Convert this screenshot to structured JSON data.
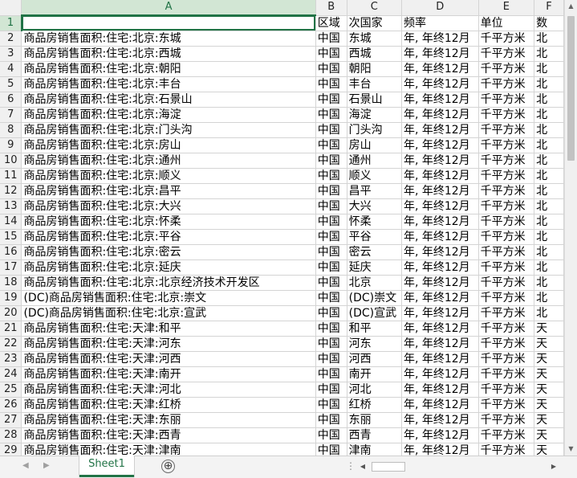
{
  "columns": [
    "A",
    "B",
    "C",
    "D",
    "E",
    "F"
  ],
  "header": [
    "",
    "区域",
    "次国家",
    "频率",
    "单位",
    "数"
  ],
  "rows": [
    [
      "1",
      "",
      "区域",
      "次国家",
      "频率",
      "单位",
      "数"
    ],
    [
      "2",
      "商品房销售面积:住宅:北京:东城",
      "中国",
      "东城",
      "年, 年终12月",
      "千平方米",
      "北"
    ],
    [
      "3",
      "商品房销售面积:住宅:北京:西城",
      "中国",
      "西城",
      "年, 年终12月",
      "千平方米",
      "北"
    ],
    [
      "4",
      "商品房销售面积:住宅:北京:朝阳",
      "中国",
      "朝阳",
      "年, 年终12月",
      "千平方米",
      "北"
    ],
    [
      "5",
      "商品房销售面积:住宅:北京:丰台",
      "中国",
      "丰台",
      "年, 年终12月",
      "千平方米",
      "北"
    ],
    [
      "6",
      "商品房销售面积:住宅:北京:石景山",
      "中国",
      "石景山",
      "年, 年终12月",
      "千平方米",
      "北"
    ],
    [
      "7",
      "商品房销售面积:住宅:北京:海淀",
      "中国",
      "海淀",
      "年, 年终12月",
      "千平方米",
      "北"
    ],
    [
      "8",
      "商品房销售面积:住宅:北京:门头沟",
      "中国",
      "门头沟",
      "年, 年终12月",
      "千平方米",
      "北"
    ],
    [
      "9",
      "商品房销售面积:住宅:北京:房山",
      "中国",
      "房山",
      "年, 年终12月",
      "千平方米",
      "北"
    ],
    [
      "10",
      "商品房销售面积:住宅:北京:通州",
      "中国",
      "通州",
      "年, 年终12月",
      "千平方米",
      "北"
    ],
    [
      "11",
      "商品房销售面积:住宅:北京:顺义",
      "中国",
      "顺义",
      "年, 年终12月",
      "千平方米",
      "北"
    ],
    [
      "12",
      "商品房销售面积:住宅:北京:昌平",
      "中国",
      "昌平",
      "年, 年终12月",
      "千平方米",
      "北"
    ],
    [
      "13",
      "商品房销售面积:住宅:北京:大兴",
      "中国",
      "大兴",
      "年, 年终12月",
      "千平方米",
      "北"
    ],
    [
      "14",
      "商品房销售面积:住宅:北京:怀柔",
      "中国",
      "怀柔",
      "年, 年终12月",
      "千平方米",
      "北"
    ],
    [
      "15",
      "商品房销售面积:住宅:北京:平谷",
      "中国",
      "平谷",
      "年, 年终12月",
      "千平方米",
      "北"
    ],
    [
      "16",
      "商品房销售面积:住宅:北京:密云",
      "中国",
      "密云",
      "年, 年终12月",
      "千平方米",
      "北"
    ],
    [
      "17",
      "商品房销售面积:住宅:北京:延庆",
      "中国",
      "延庆",
      "年, 年终12月",
      "千平方米",
      "北"
    ],
    [
      "18",
      "商品房销售面积:住宅:北京:北京经济技术开发区",
      "中国",
      "北京",
      "年, 年终12月",
      "千平方米",
      "北"
    ],
    [
      "19",
      "(DC)商品房销售面积:住宅:北京:崇文",
      "中国",
      "(DC)崇文",
      "年, 年终12月",
      "千平方米",
      "北"
    ],
    [
      "20",
      "(DC)商品房销售面积:住宅:北京:宣武",
      "中国",
      "(DC)宣武",
      "年, 年终12月",
      "千平方米",
      "北"
    ],
    [
      "21",
      "商品房销售面积:住宅:天津:和平",
      "中国",
      "和平",
      "年, 年终12月",
      "千平方米",
      "天"
    ],
    [
      "22",
      "商品房销售面积:住宅:天津:河东",
      "中国",
      "河东",
      "年, 年终12月",
      "千平方米",
      "天"
    ],
    [
      "23",
      "商品房销售面积:住宅:天津:河西",
      "中国",
      "河西",
      "年, 年终12月",
      "千平方米",
      "天"
    ],
    [
      "24",
      "商品房销售面积:住宅:天津:南开",
      "中国",
      "南开",
      "年, 年终12月",
      "千平方米",
      "天"
    ],
    [
      "25",
      "商品房销售面积:住宅:天津:河北",
      "中国",
      "河北",
      "年, 年终12月",
      "千平方米",
      "天"
    ],
    [
      "26",
      "商品房销售面积:住宅:天津:红桥",
      "中国",
      "红桥",
      "年, 年终12月",
      "千平方米",
      "天"
    ],
    [
      "27",
      "商品房销售面积:住宅:天津:东丽",
      "中国",
      "东丽",
      "年, 年终12月",
      "千平方米",
      "天"
    ],
    [
      "28",
      "商品房销售面积:住宅:天津:西青",
      "中国",
      "西青",
      "年, 年终12月",
      "千平方米",
      "天"
    ],
    [
      "29",
      "商品房销售面积:住宅:天津:津南",
      "中国",
      "津南",
      "年, 年终12月",
      "千平方米",
      "天"
    ]
  ],
  "sheet_tab": "Sheet1",
  "add_sheet_glyph": "⊕",
  "active_cell": "A1",
  "accent_color": "#217346"
}
